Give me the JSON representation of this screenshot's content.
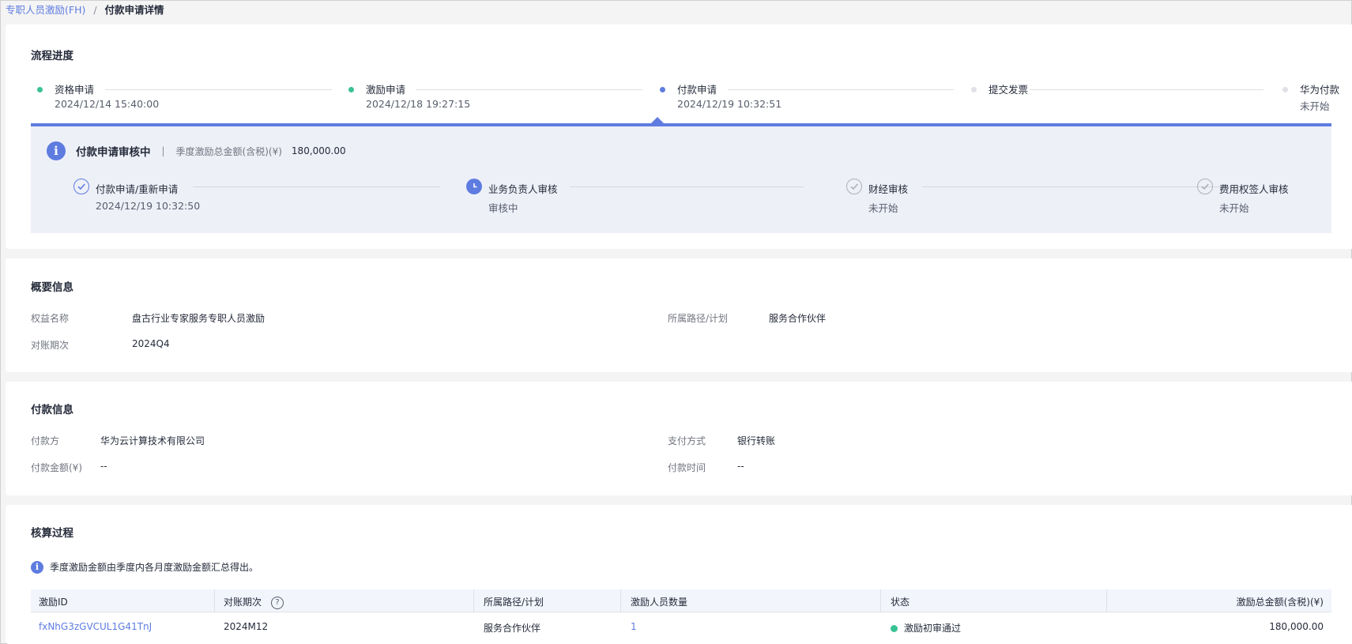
{
  "breadcrumb": {
    "parent": "专职人员激励(FH)",
    "separator": "/",
    "current": "付款申请详情"
  },
  "colors": {
    "accent": "#5e7ce0",
    "done": "#3ac295",
    "pending": "#dfe1e6"
  },
  "process": {
    "title": "流程进度",
    "steps": [
      {
        "name": "资格申请",
        "time": "2024/12/14 15:40:00",
        "status": "done"
      },
      {
        "name": "激励申请",
        "time": "2024/12/18 19:27:15",
        "status": "done"
      },
      {
        "name": "付款申请",
        "time": "2024/12/19 10:32:51",
        "status": "current"
      },
      {
        "name": "提交发票",
        "time": "",
        "status": "pending"
      },
      {
        "name": "华为付款",
        "time": "未开始",
        "status": "pending"
      }
    ],
    "review": {
      "icon": "info-icon",
      "title": "付款申请审核中",
      "divider": "|",
      "amount_label": "季度激励总金额(含税)(¥)",
      "amount": "180,000.00",
      "substeps": [
        {
          "name": "付款申请/重新申请",
          "sub": "2024/12/19 10:32:50",
          "icon": "check-circle-icon",
          "status": "done"
        },
        {
          "name": "业务负责人审核",
          "sub": "审核中",
          "icon": "clock-icon",
          "status": "current"
        },
        {
          "name": "财经审核",
          "sub": "未开始",
          "icon": "check-circle-icon",
          "status": "pending"
        },
        {
          "name": "费用权签人审核",
          "sub": "未开始",
          "icon": "check-circle-icon",
          "status": "pending"
        }
      ]
    }
  },
  "overview": {
    "title": "概要信息",
    "fields": [
      {
        "label": "权益名称",
        "value": "盘古行业专家服务专职人员激励"
      },
      {
        "label": "所属路径/计划",
        "value": "服务合作伙伴"
      },
      {
        "label": "对账期次",
        "value": "2024Q4"
      }
    ]
  },
  "payment": {
    "title": "付款信息",
    "fields": [
      {
        "label": "付款方",
        "value": "华为云计算技术有限公司"
      },
      {
        "label": "支付方式",
        "value": "银行转账"
      },
      {
        "label": "付款金额(¥)",
        "value": "--"
      },
      {
        "label": "付款时间",
        "value": "--"
      }
    ]
  },
  "accounting": {
    "title": "核算过程",
    "notice": "季度激励金额由季度内各月度激励金额汇总得出。",
    "columns": [
      "激励ID",
      "对账期次",
      "所属路径/计划",
      "激励人员数量",
      "状态",
      "激励总金额(含税)(¥)"
    ],
    "rows": [
      {
        "id": "fxNhG3zGVCUL1G41TnJ",
        "period": "2024M12",
        "path": "服务合作伙伴",
        "count": "1",
        "status": "激励初审通过",
        "amount": "180,000.00"
      }
    ]
  }
}
